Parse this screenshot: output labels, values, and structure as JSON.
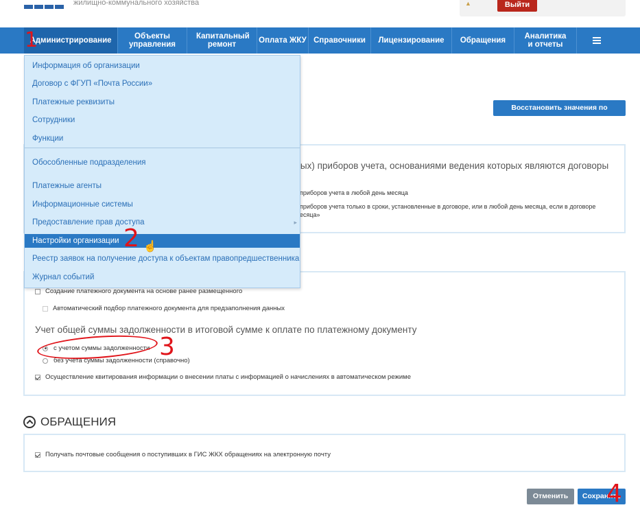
{
  "header": {
    "subtitle": "жилищно-коммунального хозяйства",
    "logout_label": "Выйти"
  },
  "nav": {
    "items": [
      {
        "label": "Администрирование"
      },
      {
        "label": "Объекты управления"
      },
      {
        "label": "Капитальный ремонт"
      },
      {
        "label": "Оплата ЖКУ"
      },
      {
        "label": "Справочники"
      },
      {
        "label": "Лицензирование"
      },
      {
        "label": "Обращения"
      },
      {
        "label": "Аналитика и отчеты"
      }
    ],
    "menu_icon": "hamburger-icon"
  },
  "dropdown": {
    "items": [
      {
        "label": "Информация об организации"
      },
      {
        "label": "Договор с ФГУП «Почта России»"
      },
      {
        "label": "Платежные реквизиты"
      },
      {
        "label": "Сотрудники"
      },
      {
        "label": "Функции"
      },
      {
        "label": "Обособленные подразделения"
      },
      {
        "label": "Платежные агенты"
      },
      {
        "label": "Информационные системы"
      },
      {
        "label": "Предоставление прав доступа"
      },
      {
        "label": "Настройки организации"
      },
      {
        "label": "Реестр заявок на получение доступа к объектам правопредшественника"
      },
      {
        "label": "Журнал событий"
      }
    ],
    "submenu_arrow": "▸"
  },
  "main": {
    "restore_label": "Восстановить значения по умолчанию",
    "panel1": {
      "title": "нных) приборов учета, основаниями ведения которых являются договоры",
      "option1": "приборов учета в любой день месяца",
      "option2": "приборов учета только в сроки, установленные в договоре, или в любой день месяца, если в договоре",
      "option2_cont": "есяца»"
    },
    "panel2": {
      "checkbox1": "Создание платежного документа на основе ранее размещенного",
      "checkbox2": "Автоматический подбор платежного документа для предзаполнения данных",
      "section_title": "Учет общей суммы задолженности в итоговой сумме к оплате по платежному документу",
      "radio1": "с учетом суммы задолженности",
      "radio2": "без учета суммы задолженности (справочно)",
      "checkbox3": "Осуществление квитирования информации о внесении платы с информацией о начислениях в автоматическом режиме"
    },
    "appeals": {
      "title": "ОБРАЩЕНИЯ",
      "checkbox": "Получать почтовые сообщения о поступивших в ГИС ЖКХ обращениях на электронную почту"
    }
  },
  "buttons": {
    "cancel_label": "Отменить",
    "save_label": "Сохранить"
  },
  "annotations": {
    "n1": "1",
    "n2": "2",
    "n3": "3",
    "n4": "4"
  },
  "colors": {
    "nav_bg": "#2a79c4",
    "dropdown_bg": "#d6ebfa",
    "logout_bg": "#b9271c",
    "annotation": "#e0141a"
  }
}
